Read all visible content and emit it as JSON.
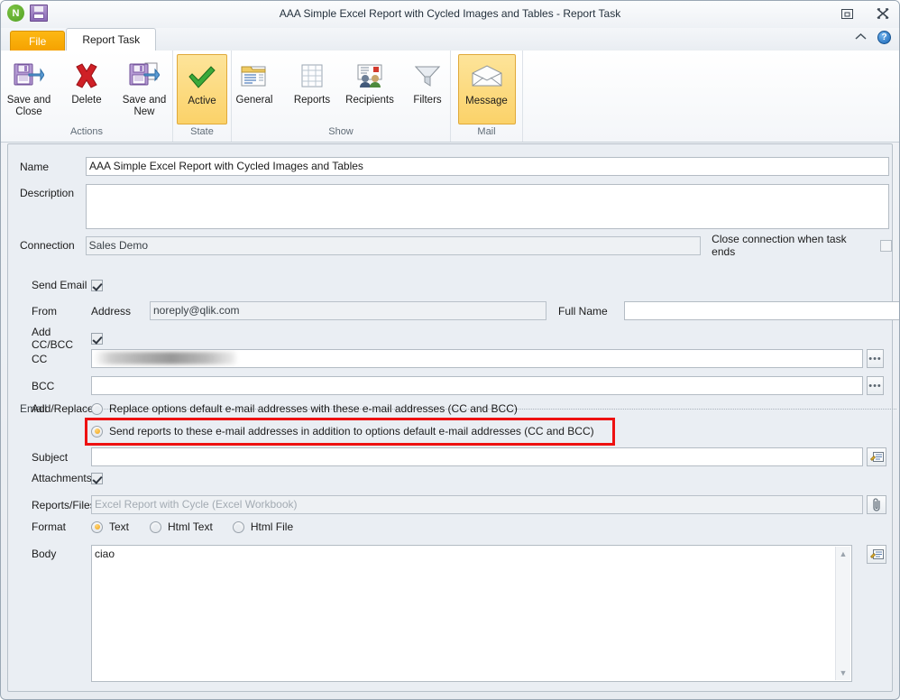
{
  "window": {
    "title": "AAA Simple Excel Report with Cycled Images and Tables - Report Task",
    "logo_text": "N",
    "icons": {
      "app_logo": "qlik-logo-icon",
      "save": "save-disk-icon",
      "restore": "restore-window-icon",
      "close": "close-window-icon",
      "collapse_ribbon": "chevron-up-icon",
      "help": "help-icon"
    },
    "help_glyph": "?"
  },
  "tabs": [
    {
      "label": "File",
      "id": "file",
      "active": false
    },
    {
      "label": "Report Task",
      "id": "report-task",
      "active": true
    }
  ],
  "ribbon": {
    "groups": [
      {
        "label": "Actions",
        "items": [
          {
            "label": "Save and\nClose",
            "line1": "Save and",
            "line2": "Close",
            "icon": "save-and-close-icon",
            "selected": false
          },
          {
            "label": "Delete",
            "line1": "Delete",
            "line2": "",
            "icon": "delete-x-icon",
            "selected": false
          },
          {
            "label": "Save and\nNew",
            "line1": "Save and",
            "line2": "New",
            "icon": "save-and-new-icon",
            "selected": false
          }
        ]
      },
      {
        "label": "State",
        "items": [
          {
            "label": "Active",
            "line1": "Active",
            "line2": "",
            "icon": "green-check-icon",
            "selected": true
          }
        ]
      },
      {
        "label": "Show",
        "items": [
          {
            "label": "General",
            "line1": "General",
            "line2": "",
            "icon": "general-document-icon",
            "selected": false
          },
          {
            "label": "Reports",
            "line1": "Reports",
            "line2": "",
            "icon": "reports-table-icon",
            "selected": false
          },
          {
            "label": "Recipients",
            "line1": "Recipients",
            "line2": "",
            "icon": "recipients-people-icon",
            "selected": false
          },
          {
            "label": "Filters",
            "line1": "Filters",
            "line2": "",
            "icon": "filter-funnel-icon",
            "selected": false
          }
        ]
      },
      {
        "label": "Mail",
        "items": [
          {
            "label": "Message",
            "line1": "Message",
            "line2": "",
            "icon": "mail-envelope-icon",
            "selected": true
          }
        ]
      }
    ]
  },
  "form": {
    "name": {
      "label": "Name",
      "value": "AAA Simple Excel Report with Cycled Images and Tables"
    },
    "description": {
      "label": "Description",
      "value": ""
    },
    "connection": {
      "label": "Connection",
      "value": "Sales Demo"
    },
    "close_connection": {
      "label": "Close connection when task ends",
      "checked": false
    },
    "email_group_label": "Email",
    "send_email": {
      "label": "Send Email",
      "checked": true
    },
    "from": {
      "label": "From",
      "address_label": "Address",
      "address_value": "noreply@qlik.com",
      "fullname_label": "Full Name",
      "fullname_value": ""
    },
    "add_ccbcc": {
      "label": "Add CC/BCC",
      "checked": true
    },
    "cc": {
      "label": "CC",
      "value": "",
      "redacted": true,
      "button": "browse-ellipsis-button"
    },
    "bcc": {
      "label": "BCC",
      "value": "",
      "button": "browse-ellipsis-button"
    },
    "add_replace": {
      "label": "Add/Replace",
      "options": [
        {
          "label": "Replace options default e-mail addresses with these e-mail addresses (CC and BCC)",
          "selected": false
        },
        {
          "label": "Send reports to these e-mail addresses in addition to options default e-mail addresses (CC and BCC)",
          "selected": true
        }
      ],
      "highlight_color": "#ee1111"
    },
    "subject": {
      "label": "Subject",
      "value": "",
      "button": "insert-tag-button"
    },
    "attachments": {
      "label": "Attachments",
      "checked": true
    },
    "reports_files": {
      "label": "Reports/Files",
      "placeholder": "Excel Report with Cycle (Excel Workbook)",
      "value": "",
      "button": "attach-paperclip-button"
    },
    "format": {
      "label": "Format",
      "options": [
        {
          "label": "Text",
          "selected": true
        },
        {
          "label": "Html Text",
          "selected": false
        },
        {
          "label": "Html File",
          "selected": false
        }
      ]
    },
    "body": {
      "label": "Body",
      "value": "ciao",
      "button": "insert-tag-button",
      "scroll_up": "▲",
      "scroll_down": "▼"
    }
  },
  "colors": {
    "file_tab": "#f5a200",
    "selected_ribbon_item": "#fbd269",
    "highlight_border": "#ee1111",
    "radio_dot": "#f0a417",
    "form_background": "#eaeef3"
  }
}
